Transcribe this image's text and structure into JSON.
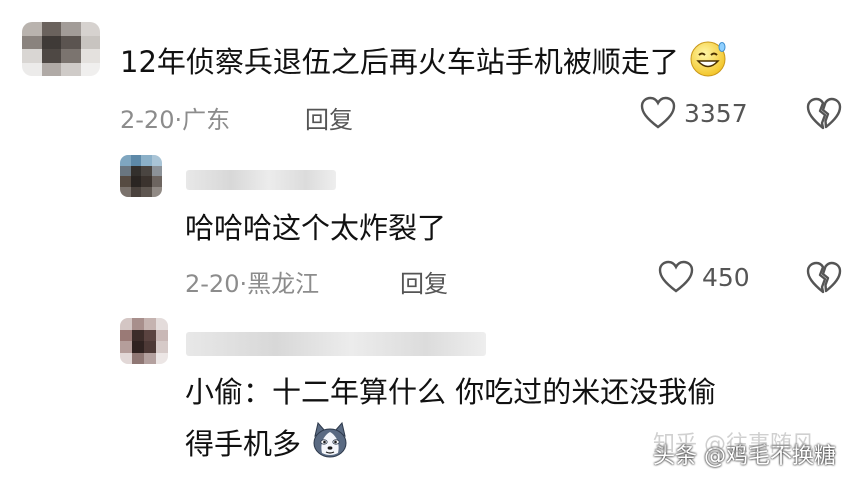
{
  "comments": [
    {
      "text": "12年侦察兵退伍之后再火车站手机被顺走了",
      "emoji": "grinning-sweat-emoji",
      "date": "2-20",
      "location": "广东",
      "reply_label": "回复",
      "likes": "3357"
    },
    {
      "text": "哈哈哈这个太炸裂了",
      "date": "2-20",
      "location": "黑龙江",
      "reply_label": "回复",
      "likes": "450"
    },
    {
      "text_line1": "小偷：十二年算什么 你吃过的米还没我偷",
      "text_line2": "得手机多",
      "emoji": "husky-dog-emoji"
    }
  ],
  "watermark": {
    "zhihu": "知乎 @往事随风",
    "toutiao": "头条 @鸡毛不换糖"
  }
}
